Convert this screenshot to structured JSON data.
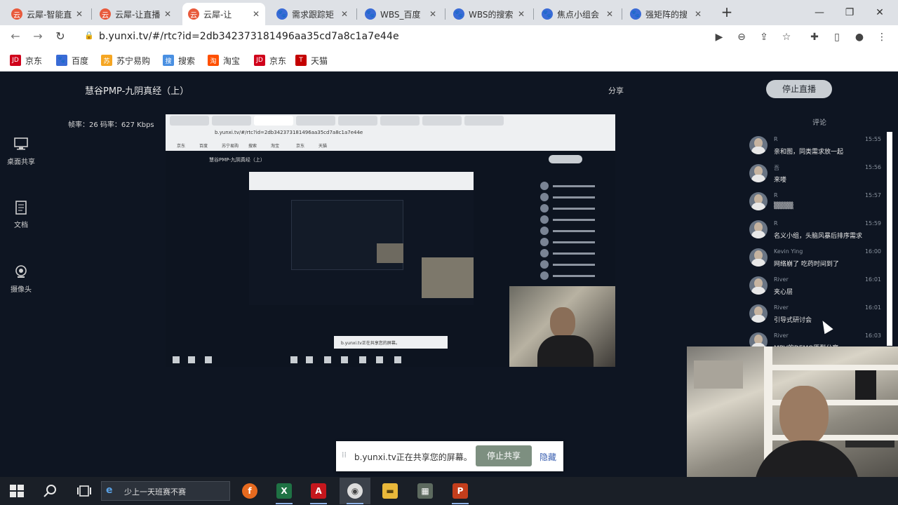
{
  "browser": {
    "tabs": [
      {
        "label": "云犀-智能直",
        "color": "#e85a3c",
        "icon": "云"
      },
      {
        "label": "云犀-让直播",
        "color": "#e85a3c",
        "icon": "云"
      },
      {
        "label": "云犀-让",
        "color": "#e85a3c",
        "icon": "云",
        "active": true
      },
      {
        "label": "需求跟踪矩",
        "color": "#3a6bd6",
        "icon": "🐾"
      },
      {
        "label": "WBS_百度",
        "color": "#3a6bd6",
        "icon": "🐾"
      },
      {
        "label": "WBS的搜索",
        "color": "#3a6bd6",
        "icon": "🐾"
      },
      {
        "label": "焦点小组会",
        "color": "#3a6bd6",
        "icon": "🐾"
      },
      {
        "label": "强矩阵的搜",
        "color": "#3a6bd6",
        "icon": "🐾"
      }
    ],
    "url": "b.yunxi.tv/#/rtc?id=2db342373181496aa35cd7a8c1a7e44e",
    "bookmarks": [
      {
        "label": "京东",
        "icon": "JD",
        "color": "#d0021b"
      },
      {
        "label": "百度",
        "icon": "🐾",
        "color": "#3a6bd6"
      },
      {
        "label": "苏宁易购",
        "icon": "苏",
        "color": "#f5a623"
      },
      {
        "label": "搜索",
        "icon": "搜",
        "color": "#4a90e2"
      },
      {
        "label": "淘宝",
        "icon": "淘",
        "color": "#ff5000"
      },
      {
        "label": "京东",
        "icon": "JD",
        "color": "#d0021b"
      },
      {
        "label": "天猫",
        "icon": "T",
        "color": "#c40000"
      }
    ]
  },
  "page": {
    "title": "慧谷PMP-九阴真经（上）",
    "share": "分享",
    "stop_live": "停止直播",
    "stats": "帧率：26 码率：627 Kbps"
  },
  "sidebar": [
    {
      "label": "桌面共享",
      "icon": "monitor-icon"
    },
    {
      "label": "文档",
      "icon": "document-icon"
    },
    {
      "label": "摄像头",
      "icon": "camera-icon"
    }
  ],
  "preview": {
    "url": "b.yunxi.tv/#/rtc?id=2db342373181496aa35cd7a8c1a7e44e",
    "title": "慧谷PMP-九阴真经（上）",
    "share_text": "b.yunxi.tv正在共享您的屏幕。"
  },
  "comments": {
    "header": "评论",
    "items": [
      {
        "name": "R",
        "time": "15:55",
        "text": "亲和图，同类需求放一起"
      },
      {
        "name": "吾",
        "time": "15:56",
        "text": "来喽"
      },
      {
        "name": "R",
        "time": "15:57",
        "text": "▒▒▒▒"
      },
      {
        "name": "R",
        "time": "15:59",
        "text": "名义小组，头脑风暴后排序需求"
      },
      {
        "name": "Kevin Ying",
        "time": "16:00",
        "text": "网络崩了 吃药时间到了"
      },
      {
        "name": "River",
        "time": "16:01",
        "text": "夹心层"
      },
      {
        "name": "River",
        "time": "16:01",
        "text": "引导式研讨会"
      },
      {
        "name": "River",
        "time": "16:03",
        "text": "MBV的DEMO原型分享"
      }
    ]
  },
  "share_bar": {
    "text": "b.yunxi.tv正在共享您的屏幕。",
    "stop": "停止共享",
    "hide": "隐藏"
  },
  "taskbar": {
    "search_text": "少上一天班赛不赛",
    "apps": [
      "edge",
      "firefox",
      "excel",
      "acrobat",
      "chrome",
      "explorer",
      "calculator",
      "powerpoint"
    ]
  }
}
